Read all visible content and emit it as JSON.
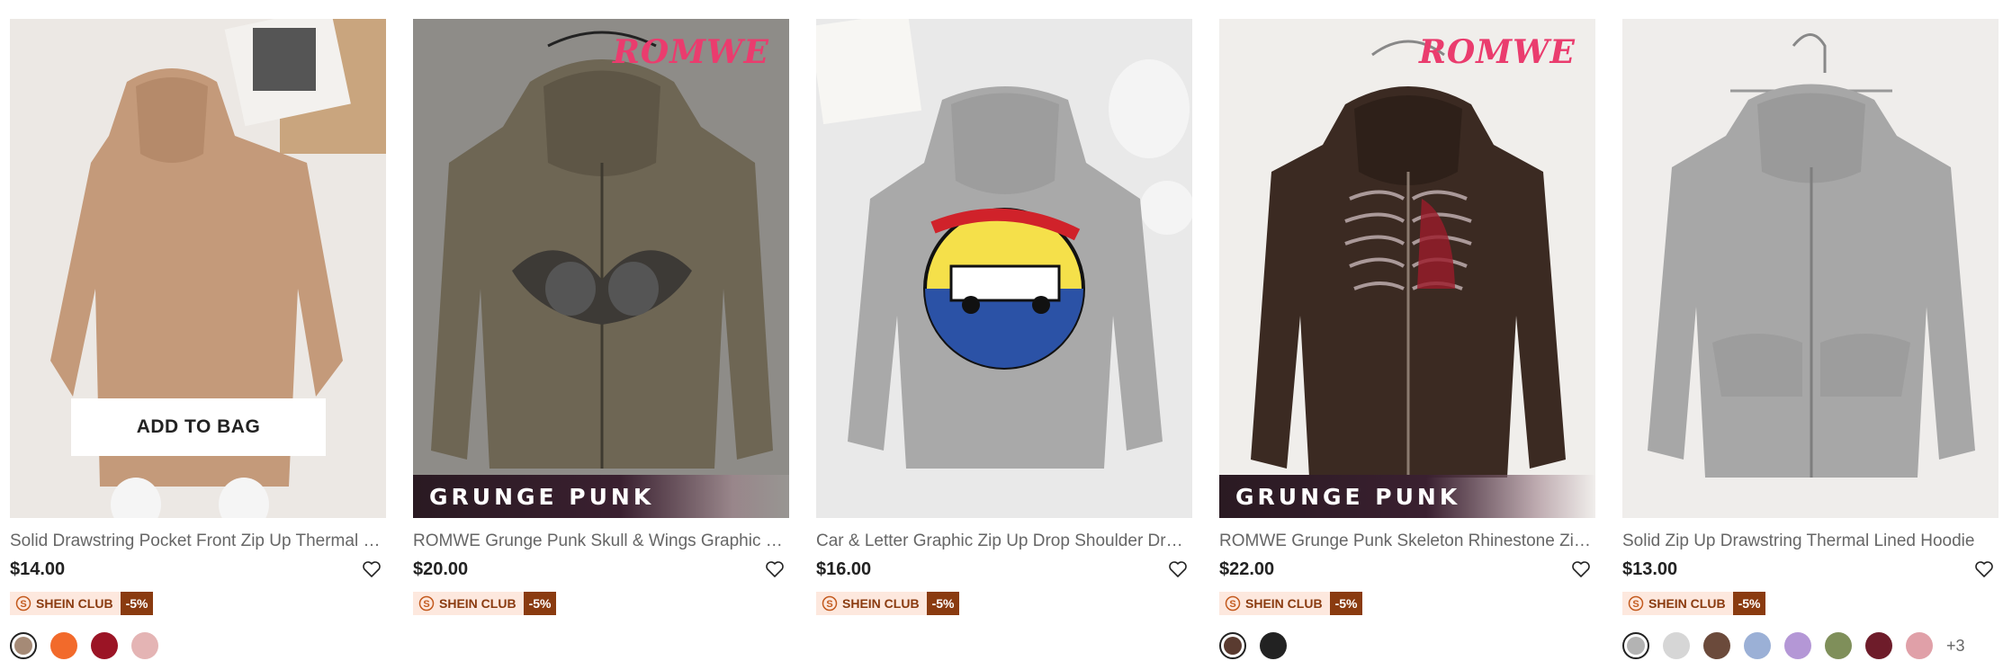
{
  "products": [
    {
      "title": "Solid Drawstring Pocket Front Zip Up Thermal Lin...",
      "price": "$14.00",
      "club_label": "SHEIN CLUB",
      "club_discount": "-5%",
      "add_to_bag": "ADD TO BAG",
      "brand": "",
      "banner": "",
      "swatches": [
        "#a58a76",
        "#f26a2b",
        "#9b1425",
        "#e4b4b4"
      ],
      "more": ""
    },
    {
      "title": "ROMWE Grunge Punk Skull & Wings Graphic Zip...",
      "price": "$20.00",
      "club_label": "SHEIN CLUB",
      "club_discount": "-5%",
      "brand": "ROMWE",
      "banner": "GRUNGE PUNK",
      "swatches": [],
      "more": ""
    },
    {
      "title": "Car & Letter Graphic Zip Up Drop Shoulder Draw...",
      "price": "$16.00",
      "club_label": "SHEIN CLUB",
      "club_discount": "-5%",
      "brand": "",
      "banner": "",
      "swatches": [],
      "more": ""
    },
    {
      "title": "ROMWE Grunge Punk Skeleton Rhinestone Zip ...",
      "price": "$22.00",
      "club_label": "SHEIN CLUB",
      "club_discount": "-5%",
      "brand": "ROMWE",
      "banner": "GRUNGE PUNK",
      "swatches": [
        "#5a3b30",
        "#222222"
      ],
      "more": ""
    },
    {
      "title": "Solid Zip Up Drawstring Thermal Lined Hoodie",
      "price": "$13.00",
      "club_label": "SHEIN CLUB",
      "club_discount": "-5%",
      "brand": "",
      "banner": "",
      "swatches": [
        "#b3b3b3",
        "#d6d6d6",
        "#6b4a3b",
        "#9bb0d6",
        "#b497d6",
        "#7f8f5a",
        "#6e1c2a",
        "#e0a0a8"
      ],
      "more": "+3"
    }
  ],
  "colors": {
    "club_bg": "#fde8de",
    "club_text": "#8a3b10",
    "brand_pink": "#ea3c6e"
  }
}
